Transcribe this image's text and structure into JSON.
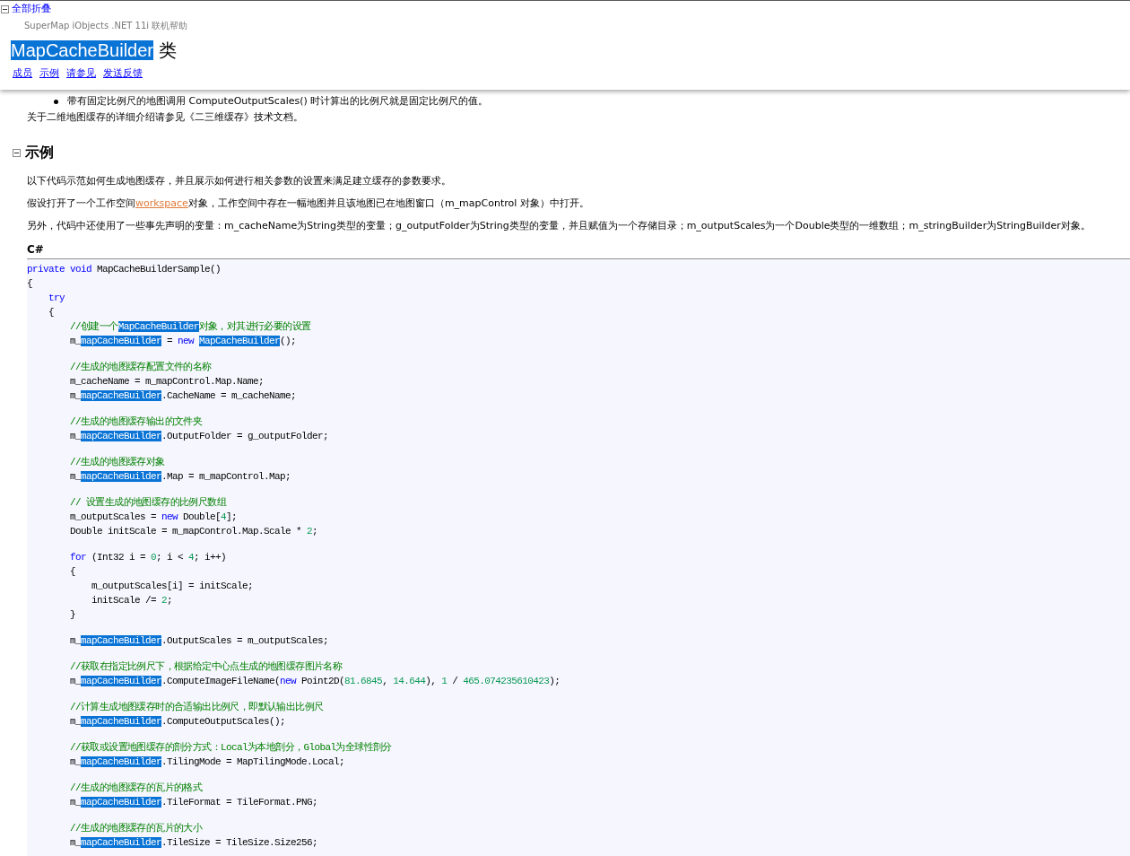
{
  "header": {
    "collapse_all": "全部折叠",
    "product": "SuperMap iObjects .NET 11i 联机帮助",
    "title": [
      {
        "kind": "match",
        "text": "MapCacheBuilder"
      },
      {
        "kind": "text",
        "text": " 类"
      }
    ],
    "links": [
      "成员",
      "示例",
      "请参见",
      "发送反馈"
    ]
  },
  "remarks": {
    "bullet": "带有固定比例尺的地图调用 ComputeOutputScales() 时计算出的比例尺就是固定比例尺的值。",
    "note": "关于二维地图缓存的详细介绍请参见《二三维缓存》技术文档。"
  },
  "example_section": {
    "title": "示例",
    "expanded": true,
    "paragraphs": [
      {
        "segments": [
          {
            "kind": "text",
            "text": "以下代码示范如何生成地图缓存，并且展示如何进行相关参数的设置来满足建立缓存的参数要求。"
          }
        ]
      },
      {
        "segments": [
          {
            "kind": "text",
            "text": "假设打开了一个工作空间"
          },
          {
            "kind": "link",
            "text": "workspace"
          },
          {
            "kind": "text",
            "text": "对象，工作空间中存在一幅地图并且该地图已在地图窗口（m_mapControl 对象）中打开。"
          }
        ]
      },
      {
        "segments": [
          {
            "kind": "text",
            "text": "另外，代码中还使用了一些事先声明的变量：m_cacheName为String类型的变量；g_outputFolder为String类型的变量，并且赋值为一个存储目录；m_outputScales为一个Double类型的一维数组；m_stringBuilder为StringBuilder对象。"
          }
        ]
      }
    ],
    "code_language": "C#",
    "code_lines": [
      {
        "kind": "code",
        "segments": [
          {
            "kind": "keyword",
            "text": "private void"
          },
          {
            "kind": "text",
            "text": " MapCacheBuilderSample()"
          }
        ]
      },
      {
        "kind": "code",
        "segments": [
          {
            "kind": "text",
            "text": "{"
          }
        ]
      },
      {
        "kind": "code",
        "segments": [
          {
            "kind": "keyword",
            "text": "    try"
          }
        ]
      },
      {
        "kind": "code",
        "segments": [
          {
            "kind": "text",
            "text": "    {"
          }
        ]
      },
      {
        "kind": "code",
        "segments": [
          {
            "kind": "comment",
            "text": "        //创建一个"
          },
          {
            "kind": "match",
            "text": "MapCacheBuilder"
          },
          {
            "kind": "comment",
            "text": "对象，对其进行必要的设置"
          }
        ]
      },
      {
        "kind": "code",
        "segments": [
          {
            "kind": "text",
            "text": "        m_"
          },
          {
            "kind": "match",
            "text": "mapCacheBuilder"
          },
          {
            "kind": "text",
            "text": " = "
          },
          {
            "kind": "keyword",
            "text": "new "
          },
          {
            "kind": "match",
            "text": "MapCacheBuilder"
          },
          {
            "kind": "text",
            "text": "();"
          }
        ]
      },
      {
        "kind": "blank"
      },
      {
        "kind": "code",
        "segments": [
          {
            "kind": "comment",
            "text": "        //生成的地图缓存配置文件的名称"
          }
        ]
      },
      {
        "kind": "code",
        "segments": [
          {
            "kind": "text",
            "text": "        m_cacheName = m_mapControl.Map.Name;"
          }
        ]
      },
      {
        "kind": "code",
        "segments": [
          {
            "kind": "text",
            "text": "        m_"
          },
          {
            "kind": "match",
            "text": "mapCacheBuilder"
          },
          {
            "kind": "text",
            "text": ".CacheName = m_cacheName;"
          }
        ]
      },
      {
        "kind": "blank"
      },
      {
        "kind": "code",
        "segments": [
          {
            "kind": "comment",
            "text": "        //生成的地图缓存输出的文件夹"
          }
        ]
      },
      {
        "kind": "code",
        "segments": [
          {
            "kind": "text",
            "text": "        m_"
          },
          {
            "kind": "match",
            "text": "mapCacheBuilder"
          },
          {
            "kind": "text",
            "text": ".OutputFolder = g_outputFolder;"
          }
        ]
      },
      {
        "kind": "blank"
      },
      {
        "kind": "code",
        "segments": [
          {
            "kind": "comment",
            "text": "        //生成的地图缓存对象"
          }
        ]
      },
      {
        "kind": "code",
        "segments": [
          {
            "kind": "text",
            "text": "        m_"
          },
          {
            "kind": "match",
            "text": "mapCacheBuilder"
          },
          {
            "kind": "text",
            "text": ".Map = m_mapControl.Map;"
          }
        ]
      },
      {
        "kind": "blank"
      },
      {
        "kind": "code",
        "segments": [
          {
            "kind": "comment",
            "text": "        // 设置生成的地图缓存的比例尺数组"
          }
        ]
      },
      {
        "kind": "code",
        "segments": [
          {
            "kind": "text",
            "text": "        m_outputScales = "
          },
          {
            "kind": "keyword",
            "text": "new"
          },
          {
            "kind": "text",
            "text": " Double["
          },
          {
            "kind": "number",
            "text": "4"
          },
          {
            "kind": "text",
            "text": "];"
          }
        ]
      },
      {
        "kind": "code",
        "segments": [
          {
            "kind": "text",
            "text": "        Double initScale = m_mapControl.Map.Scale * "
          },
          {
            "kind": "number",
            "text": "2"
          },
          {
            "kind": "text",
            "text": ";"
          }
        ]
      },
      {
        "kind": "blank"
      },
      {
        "kind": "code",
        "segments": [
          {
            "kind": "keyword",
            "text": "        for"
          },
          {
            "kind": "text",
            "text": " (Int32 i = "
          },
          {
            "kind": "number",
            "text": "0"
          },
          {
            "kind": "text",
            "text": "; i < "
          },
          {
            "kind": "number",
            "text": "4"
          },
          {
            "kind": "text",
            "text": "; i++)"
          }
        ]
      },
      {
        "kind": "code",
        "segments": [
          {
            "kind": "text",
            "text": "        {"
          }
        ]
      },
      {
        "kind": "code",
        "segments": [
          {
            "kind": "text",
            "text": "            m_outputScales[i] = initScale;"
          }
        ]
      },
      {
        "kind": "code",
        "segments": [
          {
            "kind": "text",
            "text": "            initScale /= "
          },
          {
            "kind": "number",
            "text": "2"
          },
          {
            "kind": "text",
            "text": ";"
          }
        ]
      },
      {
        "kind": "code",
        "segments": [
          {
            "kind": "text",
            "text": "        }"
          }
        ]
      },
      {
        "kind": "blank"
      },
      {
        "kind": "code",
        "segments": [
          {
            "kind": "text",
            "text": "        m_"
          },
          {
            "kind": "match",
            "text": "mapCacheBuilder"
          },
          {
            "kind": "text",
            "text": ".OutputScales = m_outputScales;"
          }
        ]
      },
      {
        "kind": "blank"
      },
      {
        "kind": "code",
        "segments": [
          {
            "kind": "comment",
            "text": "        //获取在指定比例尺下，根据给定中心点生成的地图缓存图片名称"
          }
        ]
      },
      {
        "kind": "code",
        "segments": [
          {
            "kind": "text",
            "text": "        m_"
          },
          {
            "kind": "match",
            "text": "mapCacheBuilder"
          },
          {
            "kind": "text",
            "text": ".ComputeImageFileName("
          },
          {
            "kind": "keyword",
            "text": "new"
          },
          {
            "kind": "text",
            "text": " Point2D("
          },
          {
            "kind": "number",
            "text": "81.6845"
          },
          {
            "kind": "text",
            "text": ", "
          },
          {
            "kind": "number",
            "text": "14.644"
          },
          {
            "kind": "text",
            "text": "), "
          },
          {
            "kind": "number",
            "text": "1"
          },
          {
            "kind": "text",
            "text": " / "
          },
          {
            "kind": "number",
            "text": "465.074235610423"
          },
          {
            "kind": "text",
            "text": ");"
          }
        ]
      },
      {
        "kind": "blank"
      },
      {
        "kind": "code",
        "segments": [
          {
            "kind": "comment",
            "text": "        //计算生成地图缓存时的合适输出比例尺，即默认输出比例尺"
          }
        ]
      },
      {
        "kind": "code",
        "segments": [
          {
            "kind": "text",
            "text": "        m_"
          },
          {
            "kind": "match",
            "text": "mapCacheBuilder"
          },
          {
            "kind": "text",
            "text": ".ComputeOutputScales();"
          }
        ]
      },
      {
        "kind": "blank"
      },
      {
        "kind": "code",
        "segments": [
          {
            "kind": "comment",
            "text": "        //获取或设置地图缓存的剖分方式：Local为本地剖分，Global为全球性剖分"
          }
        ]
      },
      {
        "kind": "code",
        "segments": [
          {
            "kind": "text",
            "text": "        m_"
          },
          {
            "kind": "match",
            "text": "mapCacheBuilder"
          },
          {
            "kind": "text",
            "text": ".TilingMode = MapTilingMode.Local;"
          }
        ]
      },
      {
        "kind": "blank"
      },
      {
        "kind": "code",
        "segments": [
          {
            "kind": "comment",
            "text": "        //生成的地图缓存的瓦片的格式"
          }
        ]
      },
      {
        "kind": "code",
        "segments": [
          {
            "kind": "text",
            "text": "        m_"
          },
          {
            "kind": "match",
            "text": "mapCacheBuilder"
          },
          {
            "kind": "text",
            "text": ".TileFormat = TileFormat.PNG;"
          }
        ]
      },
      {
        "kind": "blank"
      },
      {
        "kind": "code",
        "segments": [
          {
            "kind": "comment",
            "text": "        //生成的地图缓存的瓦片的大小"
          }
        ]
      },
      {
        "kind": "code",
        "segments": [
          {
            "kind": "text",
            "text": "        m_"
          },
          {
            "kind": "match",
            "text": "mapCacheBuilder"
          },
          {
            "kind": "text",
            "text": ".TileSize = TileSize.Size256;"
          }
        ]
      }
    ]
  }
}
